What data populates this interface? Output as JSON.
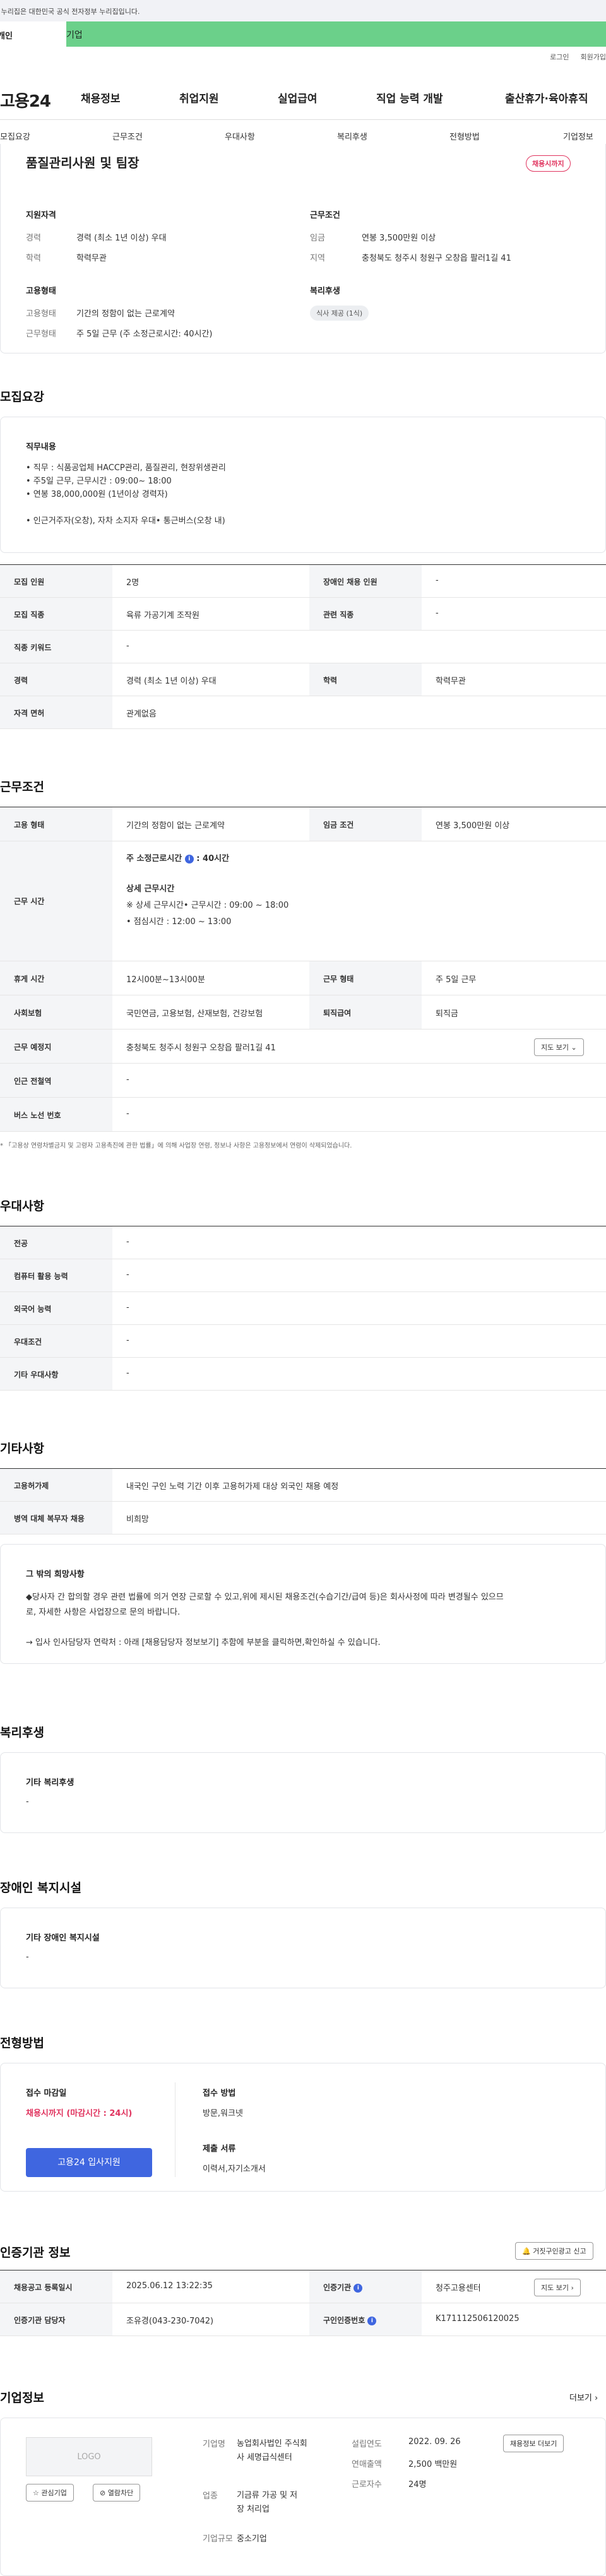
{
  "gov_banner": "이 누리집은 대한민국 공식 전자정부 누리집입니다.",
  "audience_tabs": [
    "개인",
    "기업"
  ],
  "util_links": [
    "로그인",
    "회원가입"
  ],
  "logo": "고용24",
  "gnb": [
    "채용정보",
    "취업지원",
    "실업급여",
    "직업 능력 개발",
    "출산휴가·육아휴직"
  ],
  "subnav": [
    "모집요강",
    "근무조건",
    "우대사항",
    "복리후생",
    "전형방법",
    "기업정보"
  ],
  "summary": {
    "title": "품질관리사원 및 팀장",
    "status_badge": "채용시까지",
    "qual_heading": "지원자격",
    "career_lbl": "경력",
    "career_val": "경력 (최소 1년 이상) 우대",
    "edu_lbl": "학력",
    "edu_val": "학력무관",
    "cond_heading": "근무조건",
    "wage_lbl": "임금",
    "wage_val": "연봉 3,500만원 이상",
    "region_lbl": "지역",
    "region_val": "충청북도 청주시 청원구 오창읍 팔러1길 41",
    "emp_heading": "고용형태",
    "emptype_lbl": "고용형태",
    "emptype_val": "기간의 정함이 없는 근로계약",
    "worktype_lbl": "근무형태",
    "worktype_val": "주 5일 근무 (주 소정근로시간: 40시간)",
    "welfare_heading": "복리후생",
    "welfare_pill": "식사 제공 (1식)"
  },
  "recruit": {
    "heading": "모집요강",
    "duty_heading": "직무내용",
    "duty_lines": [
      "• 직무 : 식품공업체 HACCP관리, 품질관리, 현장위생관리",
      "• 주5일 근무, 근무시간 : 09:00~ 18:00",
      "• 연봉 38,000,000원 (1년이상 경력자)",
      "",
      "• 인근거주자(오창), 자차 소지자 우대• 통근버스(오창 내)"
    ],
    "rows": [
      {
        "k1": "모집 인원",
        "v1": "2명",
        "k2": "장애인 채용 인원",
        "v2": "-"
      },
      {
        "k1": "모집 직종",
        "v1": "육류 가공기계 조작원",
        "k2": "관련 직종",
        "v2": "-"
      },
      {
        "k1": "직종 키워드",
        "v1": "-"
      },
      {
        "k1": "경력",
        "v1": "경력 (최소 1년 이상) 우대",
        "k2": "학력",
        "v2": "학력무관"
      },
      {
        "k1": "자격 면허",
        "v1": "관계없음"
      }
    ]
  },
  "work": {
    "heading": "근무조건",
    "emp_lbl": "고용 형태",
    "emp_val": "기간의 정함이 없는 근로계약",
    "wage_lbl": "임금 조건",
    "wage_val": "연봉 3,500만원 이상",
    "hours_lbl": "근무 시간",
    "hours_weekly": "주 소정근로시간",
    "hours_weekly_val": "40시간",
    "hours_detail_heading": "상세 근무시간",
    "hours_detail_1": "※ 상세 근무시간• 근무시간 : 09:00 ~ 18:00",
    "hours_detail_2": "• 점심시간 : 12:00 ~ 13:00",
    "break_lbl": "휴게 시간",
    "break_val": "12시00분~13시00분",
    "worktype_lbl": "근무 형태",
    "worktype_val": "주 5일 근무",
    "ins_lbl": "사회보험",
    "ins_val": "국민연금, 고용보험, 산재보험, 건강보험",
    "retire_lbl": "퇴직급여",
    "retire_val": "퇴직금",
    "place_lbl": "근무 예정지",
    "place_val": "충청북도 청주시 청원구 오창읍 팔러1길 41",
    "map_btn": "지도 보기",
    "subway_lbl": "인근 전철역",
    "subway_val": "-",
    "bus_lbl": "버스 노선 번호",
    "bus_val": "-",
    "note": "* 「고용상 연령차별금지 및 고령자 고용촉진에 관한 법률」에 의해 사업장 연령, 정보나 사항은 고용정보에서 연령이 삭제되었습니다."
  },
  "pref": {
    "heading": "우대사항",
    "rows": [
      {
        "k": "전공",
        "v": "-"
      },
      {
        "k": "컴퓨터 활용 능력",
        "v": "-"
      },
      {
        "k": "외국어 능력",
        "v": "-"
      },
      {
        "k": "우대조건",
        "v": "-"
      },
      {
        "k": "기타 우대사항",
        "v": "-"
      }
    ]
  },
  "etc": {
    "heading": "기타사항",
    "rows": [
      {
        "k": "고용허가제",
        "v": "내국인 구인 노력 기간 이후 고용허가제 대상 외국인 채용 예정"
      },
      {
        "k": "병역 대체 복무자 채용",
        "v": "비희망"
      }
    ],
    "box_heading": "그 밖의 희망사항",
    "box_line1": "◆당사자 간 합의할 경우 관련 법률에 의거 연장 근로할 수 있고,위에 제시된 채용조건(수습기간/급여 등)은 회사사정에 따라 변경될수 있으므",
    "box_line2": "로, 자세한 사항은 사업장으로 문의 바랍니다.",
    "box_line3": "→ 입사 인사담당자 연락처 : 아래 [채용담당자 정보보기] 추함에 부분을 클릭하면,확인하실 수 있습니다."
  },
  "welfare": {
    "heading": "복리후생",
    "sub": "기타 복리후생",
    "val": "-"
  },
  "disab": {
    "heading": "장애인 복지시설",
    "sub": "기타 장애인 복지시설",
    "val": "-"
  },
  "screen": {
    "heading": "전형방법",
    "deadline_lbl": "접수 마감일",
    "deadline_val": "채용시까지 (마감시간 : 24시)",
    "apply_btn": "고용24 입사지원",
    "method_lbl": "접수 방법",
    "method_val": "방문,워크넷",
    "docs_lbl": "제출 서류",
    "docs_val": "이력서,자기소개서"
  },
  "cert": {
    "heading": "인증기관 정보",
    "report_btn": "거짓구인광고 신고",
    "reg_lbl": "채용공고 등록일시",
    "reg_val": "2025.06.12 13:22:35",
    "org_lbl": "인증기관",
    "org_val": "청주고용센터",
    "map_btn": "지도 보기",
    "mgr_lbl": "인증기관 담당자",
    "mgr_val": "조유경(043-230-7042)",
    "id_lbl": "구인인증번호",
    "id_val": "K171112506120025"
  },
  "company": {
    "heading": "기업정보",
    "more": "더보기",
    "logo_text": "LOGO",
    "fav_btn": "관심기업",
    "block_btn": "열람차단",
    "name_lbl": "기업명",
    "name_val": "농업회사법인 주식회사 세명급식센터",
    "ind_lbl": "업종",
    "ind_val": "기금류 가공 및 저장 처리업",
    "size_lbl": "기업규모",
    "size_val": "중소기업",
    "est_lbl": "설립연도",
    "est_val": "2022. 09. 26",
    "sales_lbl": "연매출액",
    "sales_val": "2,500 백만원",
    "emp_lbl": "근로자수",
    "emp_val": "24명",
    "jobs_btn": "채용정보 더보기"
  },
  "colors": {
    "accent": "#3f66e0",
    "green": "#6bd08a",
    "red": "#e0335e"
  }
}
